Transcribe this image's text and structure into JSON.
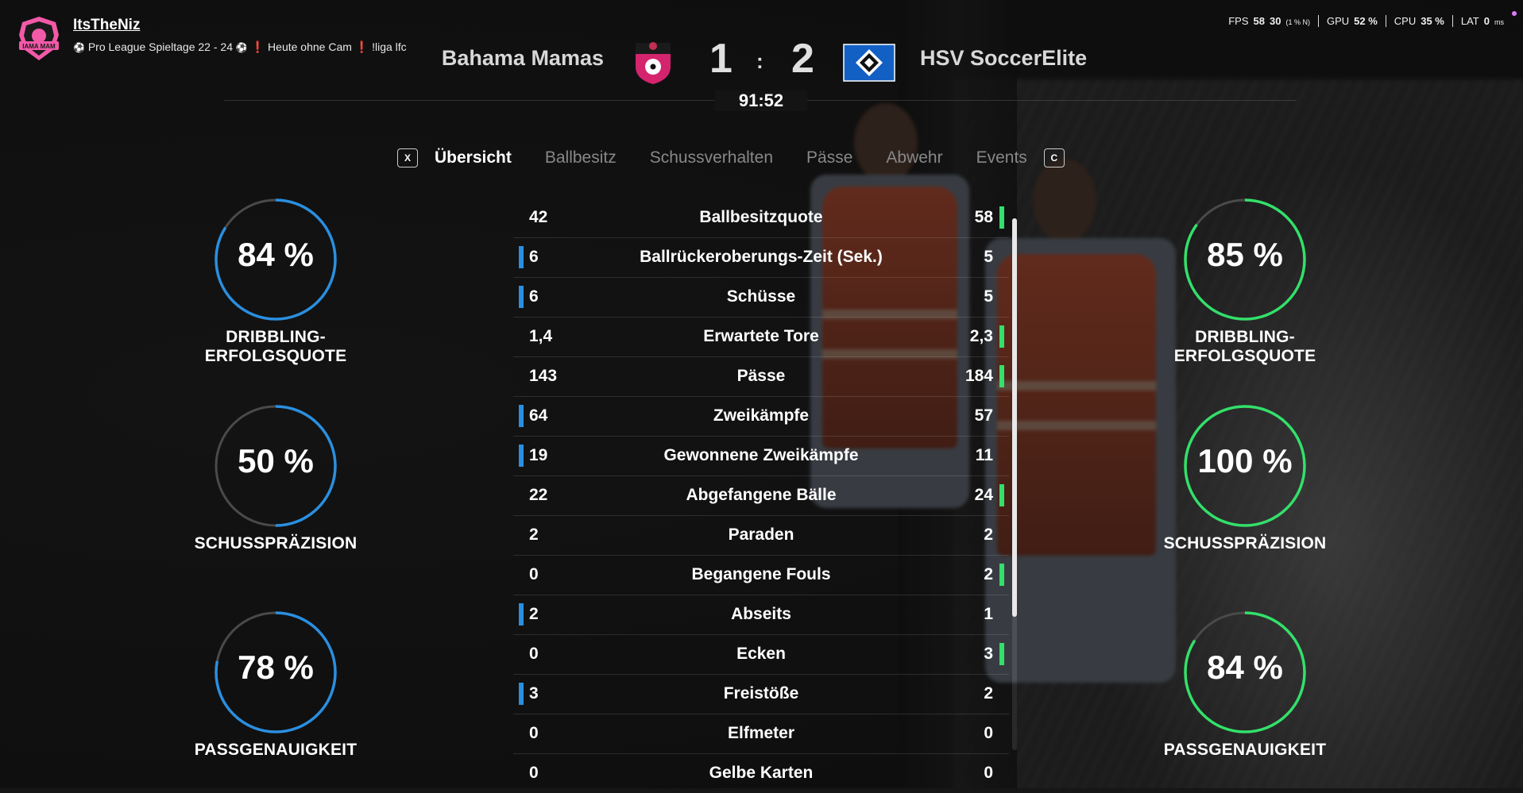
{
  "streamer": {
    "name": "ItsTheNiz",
    "logo_text": "IAMA MAM",
    "title_ball_1": "⚽",
    "title_part1": "Pro League Spieltage 22 - 24",
    "title_ball_2": "⚽",
    "title_excl_1": "❗",
    "title_part2": "Heute ohne Cam",
    "title_excl_2": "❗",
    "title_part3": "!liga lfc"
  },
  "perf": {
    "fps_label": "FPS",
    "fps_value": "58",
    "fps_low": "30",
    "fps_low_note": "(1 % N)",
    "gpu_label": "GPU",
    "gpu_value": "52 %",
    "cpu_label": "CPU",
    "cpu_value": "35 %",
    "lat_label": "LAT",
    "lat_value": "0",
    "lat_unit": "ms"
  },
  "match": {
    "home_team": "Bahama Mamas",
    "away_team": "HSV SoccerElite",
    "home_score": "1",
    "away_score": "2",
    "separator": ":",
    "clock": "91:52"
  },
  "tabs": {
    "prev_key": "X",
    "next_key": "C",
    "items": [
      "Übersicht",
      "Ballbesitz",
      "Schussverhalten",
      "Pässe",
      "Abwehr",
      "Events"
    ],
    "active_index": 0
  },
  "gauges": {
    "home": [
      {
        "value_text": "84 %",
        "value": 84,
        "label": "DRIBBLING-ERFOLGSQUOTE"
      },
      {
        "value_text": "50 %",
        "value": 50,
        "label": "SCHUSSPRÄZISION"
      },
      {
        "value_text": "78 %",
        "value": 78,
        "label": "PASSGENAUIGKEIT"
      }
    ],
    "away": [
      {
        "value_text": "85 %",
        "value": 85,
        "label": "DRIBBLING-ERFOLGSQUOTE"
      },
      {
        "value_text": "100 %",
        "value": 100,
        "label": "SCHUSSPRÄZISION"
      },
      {
        "value_text": "84 %",
        "value": 84,
        "label": "PASSGENAUIGKEIT"
      }
    ],
    "home_color": "#2a8fe0",
    "away_color": "#33e06a"
  },
  "stats": [
    {
      "home": "42",
      "name": "Ballbesitzquote",
      "away": "58",
      "leader": "away"
    },
    {
      "home": "6",
      "name": "Ballrückeroberungs-Zeit (Sek.)",
      "away": "5",
      "leader": "home"
    },
    {
      "home": "6",
      "name": "Schüsse",
      "away": "5",
      "leader": "home"
    },
    {
      "home": "1,4",
      "name": "Erwartete Tore",
      "away": "2,3",
      "leader": "away"
    },
    {
      "home": "143",
      "name": "Pässe",
      "away": "184",
      "leader": "away"
    },
    {
      "home": "64",
      "name": "Zweikämpfe",
      "away": "57",
      "leader": "home"
    },
    {
      "home": "19",
      "name": "Gewonnene Zweikämpfe",
      "away": "11",
      "leader": "home"
    },
    {
      "home": "22",
      "name": "Abgefangene Bälle",
      "away": "24",
      "leader": "away"
    },
    {
      "home": "2",
      "name": "Paraden",
      "away": "2",
      "leader": "none"
    },
    {
      "home": "0",
      "name": "Begangene Fouls",
      "away": "2",
      "leader": "away"
    },
    {
      "home": "2",
      "name": "Abseits",
      "away": "1",
      "leader": "home"
    },
    {
      "home": "0",
      "name": "Ecken",
      "away": "3",
      "leader": "away"
    },
    {
      "home": "3",
      "name": "Freistöße",
      "away": "2",
      "leader": "home"
    },
    {
      "home": "0",
      "name": "Elfmeter",
      "away": "0",
      "leader": "none"
    },
    {
      "home": "0",
      "name": "Gelbe Karten",
      "away": "0",
      "leader": "none"
    }
  ]
}
